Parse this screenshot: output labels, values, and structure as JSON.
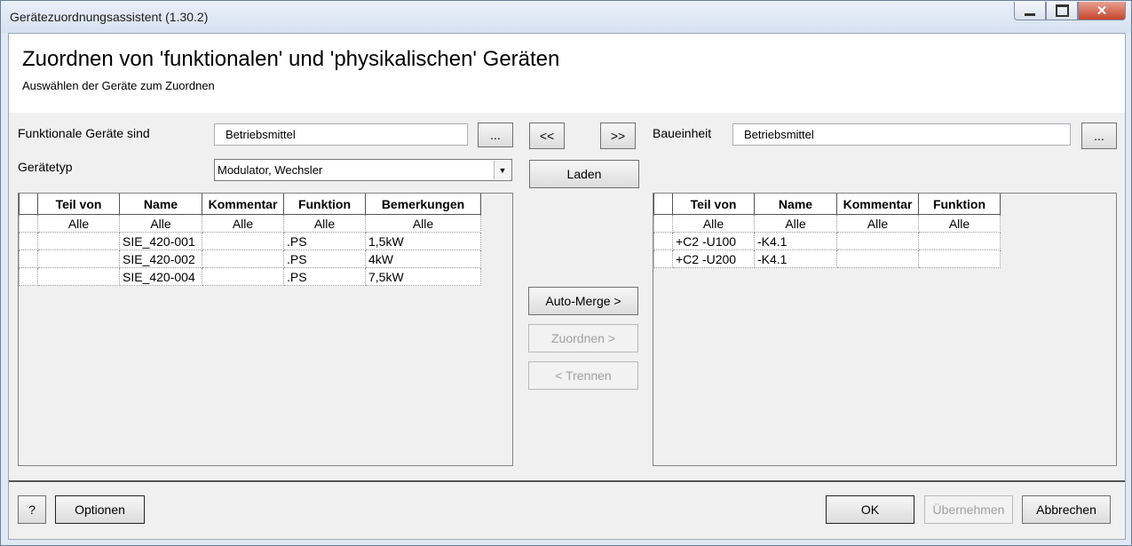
{
  "window": {
    "title": "Gerätezuordnungsassistent (1.30.2)",
    "controls": {
      "minimize": "minimize",
      "maximize": "maximize",
      "close": "✕"
    }
  },
  "header": {
    "title": "Zuordnen von 'funktionalen' und 'physikalischen' Geräten",
    "subtitle": "Auswählen der Geräte zum Zuordnen"
  },
  "left": {
    "functional_label": "Funktionale Geräte sind",
    "functional_value": "Betriebsmittel",
    "browse_label": "...",
    "type_label": "Gerätetyp",
    "type_value": "Modulator, Wechsler",
    "table": {
      "columns": [
        "Teil von",
        "Name",
        "Kommentar",
        "Funktion",
        "Bemerkungen"
      ],
      "filter": [
        "Alle",
        "Alle",
        "Alle",
        "Alle",
        "Alle"
      ],
      "rows": [
        [
          "",
          "SIE_420-001",
          "",
          ".PS",
          "1,5kW"
        ],
        [
          "",
          "SIE_420-002",
          "",
          ".PS",
          "4kW"
        ],
        [
          "",
          "SIE_420-004",
          "",
          ".PS",
          "7,5kW"
        ]
      ]
    }
  },
  "middle": {
    "move_left": "<<",
    "move_right": ">>",
    "load": "Laden",
    "auto_merge": "Auto-Merge >",
    "assign": "Zuordnen >",
    "separate": "< Trennen"
  },
  "right": {
    "unit_label": "Baueinheit",
    "unit_value": "Betriebsmittel",
    "browse_label": "...",
    "table": {
      "columns": [
        "Teil von",
        "Name",
        "Kommentar",
        "Funktion"
      ],
      "filter": [
        "Alle",
        "Alle",
        "Alle",
        "Alle"
      ],
      "rows": [
        [
          "+C2 -U100",
          "-K4.1",
          "",
          ""
        ],
        [
          "+C2 -U200",
          "-K4.1",
          "",
          ""
        ]
      ]
    }
  },
  "footer": {
    "help": "?",
    "options": "Optionen",
    "ok": "OK",
    "apply": "Übernehmen",
    "cancel": "Abbrechen"
  }
}
